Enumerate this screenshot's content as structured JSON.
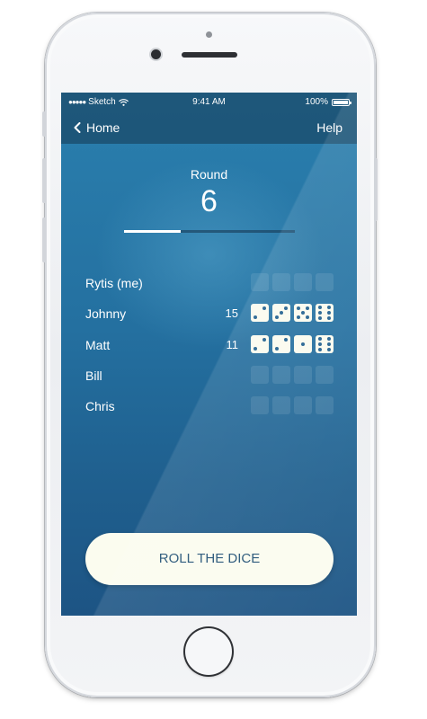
{
  "status_bar": {
    "carrier": "Sketch",
    "time": "9:41 AM",
    "battery": "100%"
  },
  "nav": {
    "back_label": "Home",
    "help_label": "Help"
  },
  "round": {
    "label": "Round",
    "number": "6",
    "progress": 0.33
  },
  "players": [
    {
      "name": "Rytis (me)",
      "score": "",
      "dice": [
        0,
        0,
        0,
        0
      ]
    },
    {
      "name": "Johnny",
      "score": "15",
      "dice": [
        2,
        3,
        5,
        6
      ]
    },
    {
      "name": "Matt",
      "score": "11",
      "dice": [
        2,
        2,
        1,
        6
      ]
    },
    {
      "name": "Bill",
      "score": "",
      "dice": [
        0,
        0,
        0,
        0
      ]
    },
    {
      "name": "Chris",
      "score": "",
      "dice": [
        0,
        0,
        0,
        0
      ]
    }
  ],
  "roll_button": {
    "label": "ROLL THE DICE"
  },
  "colors": {
    "screen_top": "#2a7fae",
    "screen_bottom": "#1d5484",
    "die_face": "#fbfbee",
    "button_bg": "#fbfcef",
    "button_text": "#1f4f73"
  }
}
